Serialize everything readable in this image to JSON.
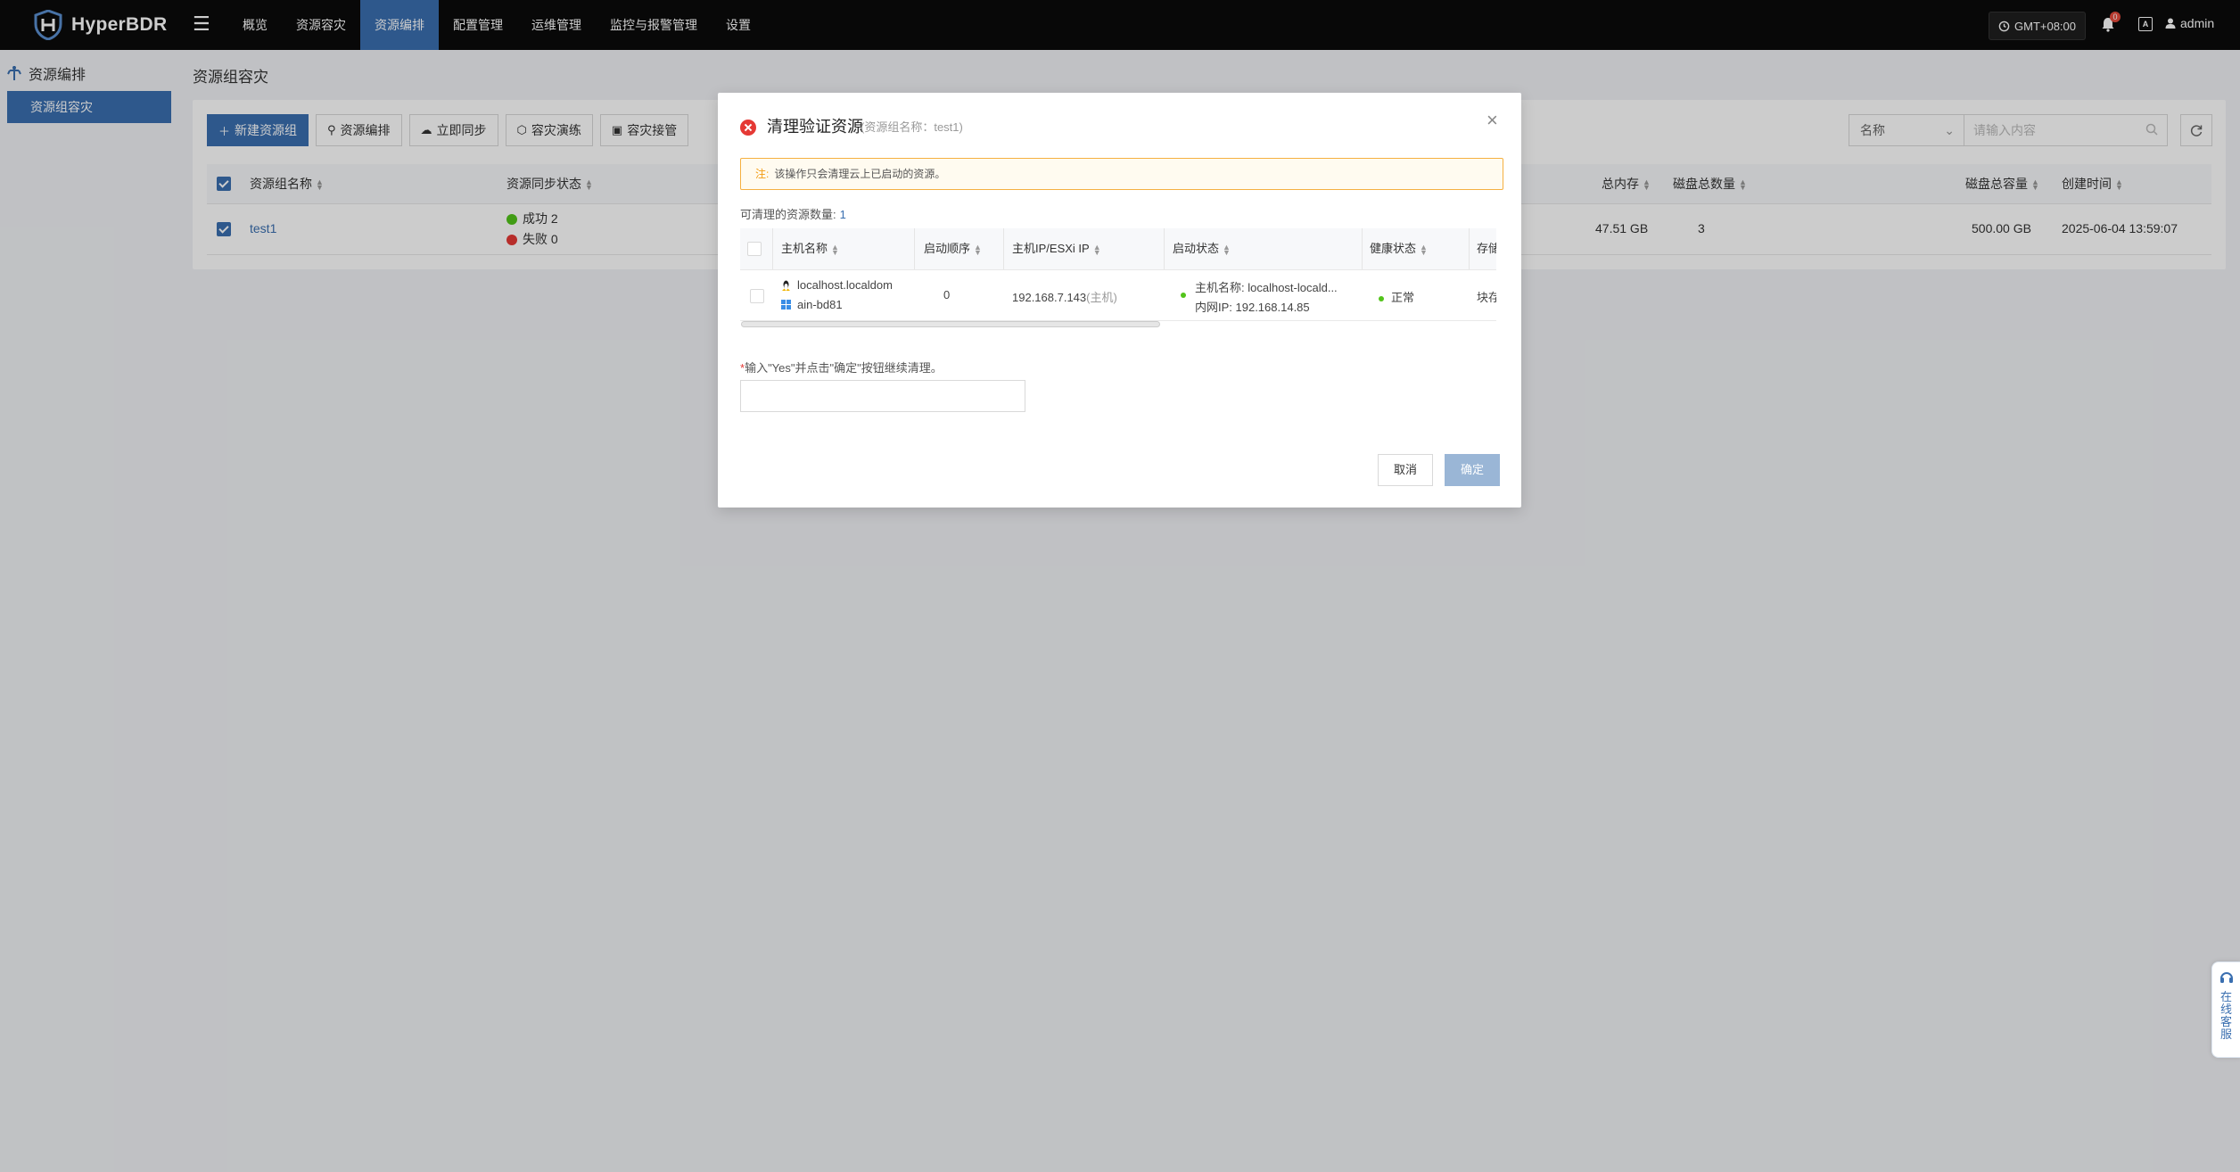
{
  "app": {
    "name": "HyperBDR"
  },
  "nav": {
    "items": [
      {
        "label": "概览"
      },
      {
        "label": "资源容灾"
      },
      {
        "label": "资源编排",
        "active": true
      },
      {
        "label": "配置管理"
      },
      {
        "label": "运维管理"
      },
      {
        "label": "监控与报警管理"
      },
      {
        "label": "设置"
      }
    ]
  },
  "header": {
    "timezone": "GMT+08:00",
    "notification_count": "0",
    "lang_glyph": "A",
    "user": "admin"
  },
  "sidebar": {
    "title": "资源编排",
    "items": [
      {
        "label": "资源组容灾",
        "active": true
      }
    ]
  },
  "page": {
    "title": "资源组容灾"
  },
  "toolbar": {
    "new_group": "新建资源组",
    "orchestrate": "资源编排",
    "sync_now": "立即同步",
    "dr_drill": "容灾演练",
    "dr_takeover": "容灾接管"
  },
  "search": {
    "field": "名称",
    "placeholder": "请输入内容"
  },
  "table": {
    "headers": {
      "name": "资源组名称",
      "sync_status": "资源同步状态",
      "total_memory": "总内存",
      "disk_count": "磁盘总数量",
      "disk_capacity": "磁盘总容量",
      "created": "创建时间"
    },
    "rows": [
      {
        "name": "test1",
        "success": "成功 2",
        "fail": "失败 0",
        "total_memory": "47.51 GB",
        "disk_count": "3",
        "disk_capacity": "500.00 GB",
        "created": "2025-06-04 13:59:07"
      }
    ]
  },
  "modal": {
    "title": "清理验证资源",
    "subtitle": "(资源组名称：test1)",
    "notice_label": "注:",
    "notice_text": "该操作只会清理云上已启动的资源。",
    "count_label": "可清理的资源数量:",
    "count_value": "1",
    "columns": {
      "host": "主机名称",
      "boot_order": "启动顺序",
      "host_ip": "主机IP/ESXi IP",
      "boot_status": "启动状态",
      "health": "健康状态",
      "storage": "存储"
    },
    "rows": [
      {
        "host_line1": "localhost.localdom",
        "host_line2": "ain-bd81",
        "boot_order": "0",
        "ip": "192.168.7.143",
        "ip_tag": "(主机)",
        "status_line1": "主机名称: localhost-locald...",
        "status_line2": "内网IP: 192.168.14.85",
        "health": "正常",
        "storage": "块存"
      }
    ],
    "hint": "输入\"Yes\"并点击\"确定\"按钮继续清理。",
    "required_mark": "*",
    "input_value": "",
    "cancel": "取消",
    "confirm": "确定"
  },
  "support": {
    "label": "在线客服"
  },
  "colors": {
    "accent": "#3a6fb0",
    "success": "#52c41a",
    "danger": "#e53935",
    "warning": "#f39c12"
  }
}
